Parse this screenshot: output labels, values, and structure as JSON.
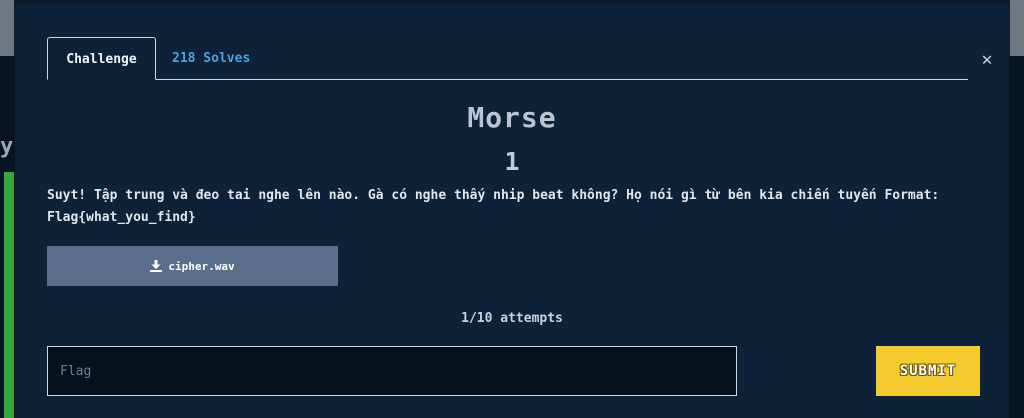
{
  "colors": {
    "modal_bg": "#0d2238",
    "accent_link": "#4aa3df",
    "download_button": "#5a6f8c",
    "submit_button": "#f3cb2e"
  },
  "background": {
    "partial_heading_letter": "y"
  },
  "modal": {
    "close_icon": "close-icon",
    "tabs": [
      {
        "label": "Challenge",
        "active": true
      },
      {
        "label": "218 Solves",
        "active": false
      }
    ],
    "challenge": {
      "name": "Morse",
      "value": "1",
      "description_line1": "Suyt! Tập trung và đeo tai nghe lên nào. Gà có nghe thấy nhip beat không? Họ nói gì từ bên kia chiến tuyến Format:",
      "description_line2": "Flag{what_you_find}",
      "file": {
        "name": "cipher.wav",
        "icon": "download-icon"
      },
      "attempts": "1/10 attempts",
      "flag_input": {
        "placeholder": "Flag",
        "value": ""
      },
      "submit_label": "SUBMIT"
    }
  }
}
